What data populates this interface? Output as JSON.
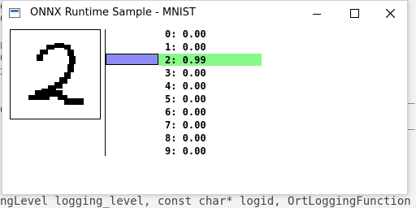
{
  "background_text": {
    "left_lines": [
      "g",
      "C",
      "",
      "n",
      "C",
      "x",
      ")",
      "",
      "C",
      "",
      ")"
    ],
    "right_lines": [
      "",
      "",
      "",
      "",
      "",
      "",
      "",
      "_",
      "",
      "_",
      ""
    ],
    "bottom_line": "ngLevel logging_level, const char* logid, OrtLoggingFunction loggi"
  },
  "window": {
    "title": "ONNX Runtime Sample - MNIST",
    "icon": "window-app-icon",
    "controls": {
      "minimize_icon": "minimize-icon",
      "maximize_icon": "maximize-icon",
      "close_icon": "close-icon"
    }
  },
  "drawn_digit": "2",
  "results": [
    {
      "label": "0: 0.00",
      "prob": 0.0
    },
    {
      "label": "1: 0.00",
      "prob": 0.0
    },
    {
      "label": "2: 0.99",
      "prob": 0.99
    },
    {
      "label": "3: 0.00",
      "prob": 0.0
    },
    {
      "label": "4: 0.00",
      "prob": 0.0
    },
    {
      "label": "5: 0.00",
      "prob": 0.0
    },
    {
      "label": "6: 0.00",
      "prob": 0.0
    },
    {
      "label": "7: 0.00",
      "prob": 0.0
    },
    {
      "label": "8: 0.00",
      "prob": 0.0
    },
    {
      "label": "9: 0.00",
      "prob": 0.0
    }
  ],
  "colors": {
    "highlight": "#88f88a",
    "bar": "#8c8cf0"
  }
}
